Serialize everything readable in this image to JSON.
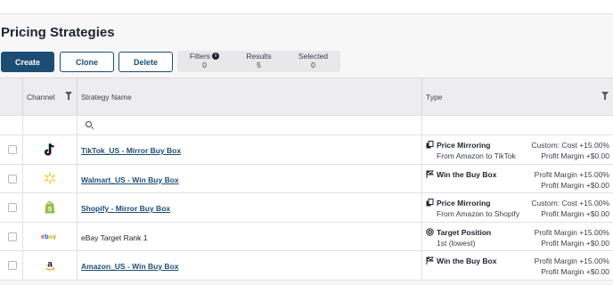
{
  "page": {
    "title": "Pricing Strategies"
  },
  "toolbar": {
    "create_label": "Create",
    "clone_label": "Clone",
    "delete_label": "Delete"
  },
  "stats": {
    "filters_label": "Filters",
    "filters_value": "0",
    "results_label": "Results",
    "results_value": "5",
    "selected_label": "Selected",
    "selected_value": "0"
  },
  "table": {
    "headers": {
      "channel": "Channel",
      "name": "Strategy Name",
      "type": "Type"
    },
    "rows": [
      {
        "channel_icon": "tiktok-icon",
        "name": "TikTok_US - Mirror Buy Box",
        "name_is_link": true,
        "type_icon": "copy-icon",
        "type_title": "Price Mirroring",
        "type_sub": "From Amazon to TikTok",
        "rule1": "Custom: Cost +15.00%",
        "rule2": "Profit Margin +$0.00"
      },
      {
        "channel_icon": "walmart-icon",
        "name": "Walmart_US - Win Buy Box",
        "name_is_link": true,
        "type_icon": "flag-icon",
        "type_title": "Win the Buy Box",
        "type_sub": "",
        "rule1": "Profit Margin +15.00%",
        "rule2": "Profit Margin +$0.00"
      },
      {
        "channel_icon": "shopify-icon",
        "name": "Shopify - Mirror Buy Box",
        "name_is_link": true,
        "type_icon": "copy-icon",
        "type_title": "Price Mirroring",
        "type_sub": "From Amazon to Shopify",
        "rule1": "Custom: Cost +15.00%",
        "rule2": "Profit Margin +$0.00"
      },
      {
        "channel_icon": "ebay-icon",
        "name": "eBay Target Rank 1",
        "name_is_link": false,
        "type_icon": "target-icon",
        "type_title": "Target Position",
        "type_sub": "1st (lowest)",
        "rule1": "Profit Margin +15.00%",
        "rule2": "Profit Margin +$0.00"
      },
      {
        "channel_icon": "amazon-icon",
        "name": "Amazon_US - Win Buy Box",
        "name_is_link": true,
        "type_icon": "flag-icon",
        "type_title": "Win the Buy Box",
        "type_sub": "",
        "rule1": "Profit Margin +15.00%",
        "rule2": "Profit Margin +$0.00"
      }
    ]
  },
  "colors": {
    "primary": "#1c4e75",
    "walmart": "#ffc220",
    "shopify": "#95bf47"
  }
}
